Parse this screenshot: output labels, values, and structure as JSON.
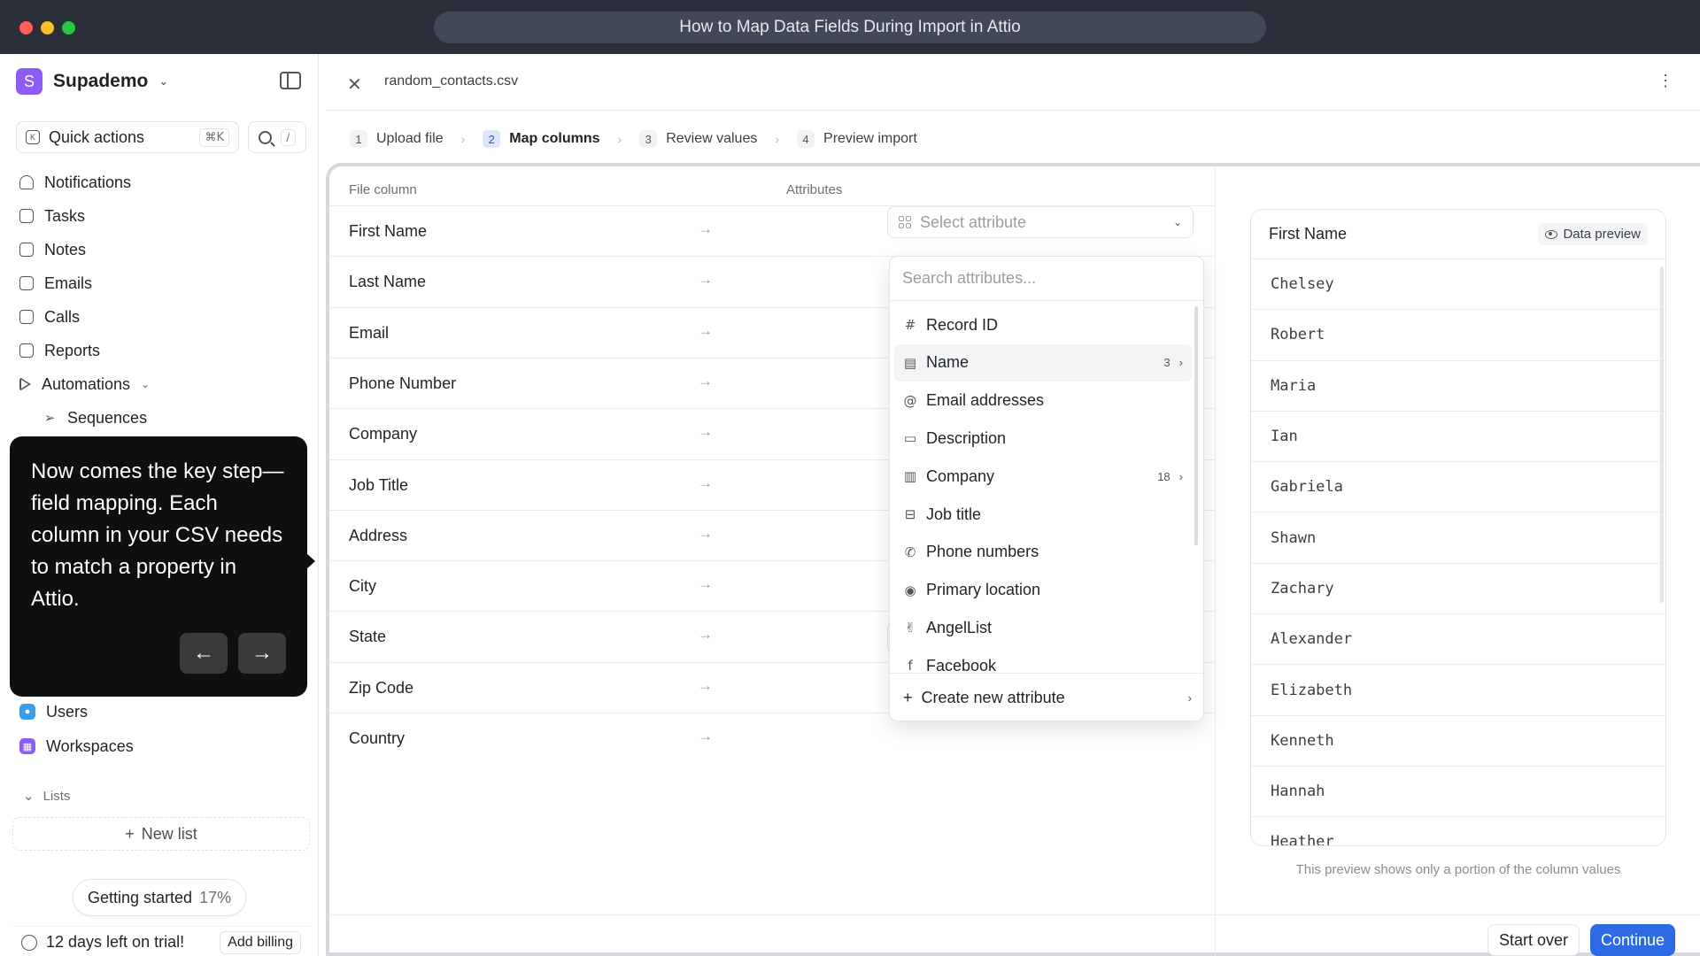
{
  "window": {
    "title": "How to Map Data Fields During Import in Attio"
  },
  "sidebar": {
    "workspace_initial": "S",
    "workspace_name": "Supademo",
    "quick_actions": {
      "label": "Quick actions",
      "shortcut": "⌘K",
      "search_shortcut": "/"
    },
    "items": [
      {
        "label": "Notifications",
        "icon": "bell-icon"
      },
      {
        "label": "Tasks",
        "icon": "check-square-icon"
      },
      {
        "label": "Notes",
        "icon": "note-icon"
      },
      {
        "label": "Emails",
        "icon": "mail-icon"
      },
      {
        "label": "Calls",
        "icon": "video-icon"
      },
      {
        "label": "Reports",
        "icon": "chart-icon"
      },
      {
        "label": "Automations",
        "icon": "play-icon"
      },
      {
        "label": "Sequences",
        "icon": "send-icon"
      }
    ],
    "records": [
      {
        "label": "Users",
        "color": "#3b9eed"
      },
      {
        "label": "Workspaces",
        "color": "#8b5cf6"
      }
    ],
    "lists_label": "Lists",
    "new_list_label": "New list",
    "getting_started": {
      "label": "Getting started",
      "percent": "17%"
    },
    "trial": {
      "label": "12 days left on trial!",
      "button": "Add billing"
    }
  },
  "tooltip": {
    "text": "Now comes the key step—field mapping. Each column in your CSV needs to match a property in Attio.",
    "prev": "←",
    "next": "→"
  },
  "main": {
    "filename": "random_contacts.csv",
    "steps": [
      {
        "num": "1",
        "label": "Upload file"
      },
      {
        "num": "2",
        "label": "Map columns"
      },
      {
        "num": "3",
        "label": "Review values"
      },
      {
        "num": "4",
        "label": "Preview import"
      }
    ],
    "active_step": 2,
    "headers": {
      "file_column": "File column",
      "attributes": "Attributes"
    },
    "file_columns": [
      "First Name",
      "Last Name",
      "Email",
      "Phone Number",
      "Company",
      "Job Title",
      "Address",
      "City",
      "State",
      "Zip Code",
      "Country"
    ],
    "select_placeholder": "Select attribute",
    "dropdown": {
      "search_placeholder": "Search attributes...",
      "items": [
        {
          "label": "Record ID",
          "icon": "#"
        },
        {
          "label": "Name",
          "icon": "▤",
          "count": "3"
        },
        {
          "label": "Email addresses",
          "icon": "@"
        },
        {
          "label": "Description",
          "icon": "▭"
        },
        {
          "label": "Company",
          "icon": "▥",
          "count": "18"
        },
        {
          "label": "Job title",
          "icon": "⊟"
        },
        {
          "label": "Phone numbers",
          "icon": "✆"
        },
        {
          "label": "Primary location",
          "icon": "◉"
        },
        {
          "label": "AngelList",
          "icon": "✌"
        },
        {
          "label": "Facebook",
          "icon": "f"
        }
      ],
      "footer": "Create new attribute"
    },
    "preview": {
      "title": "First Name",
      "badge": "Data preview",
      "values": [
        "Chelsey",
        "Robert",
        "Maria",
        "Ian",
        "Gabriela",
        "Shawn",
        "Zachary",
        "Alexander",
        "Elizabeth",
        "Kenneth",
        "Hannah",
        "Heather"
      ],
      "note": "This preview shows only a portion of the column values"
    },
    "buttons": {
      "start_over": "Start over",
      "continue": "Continue"
    }
  }
}
